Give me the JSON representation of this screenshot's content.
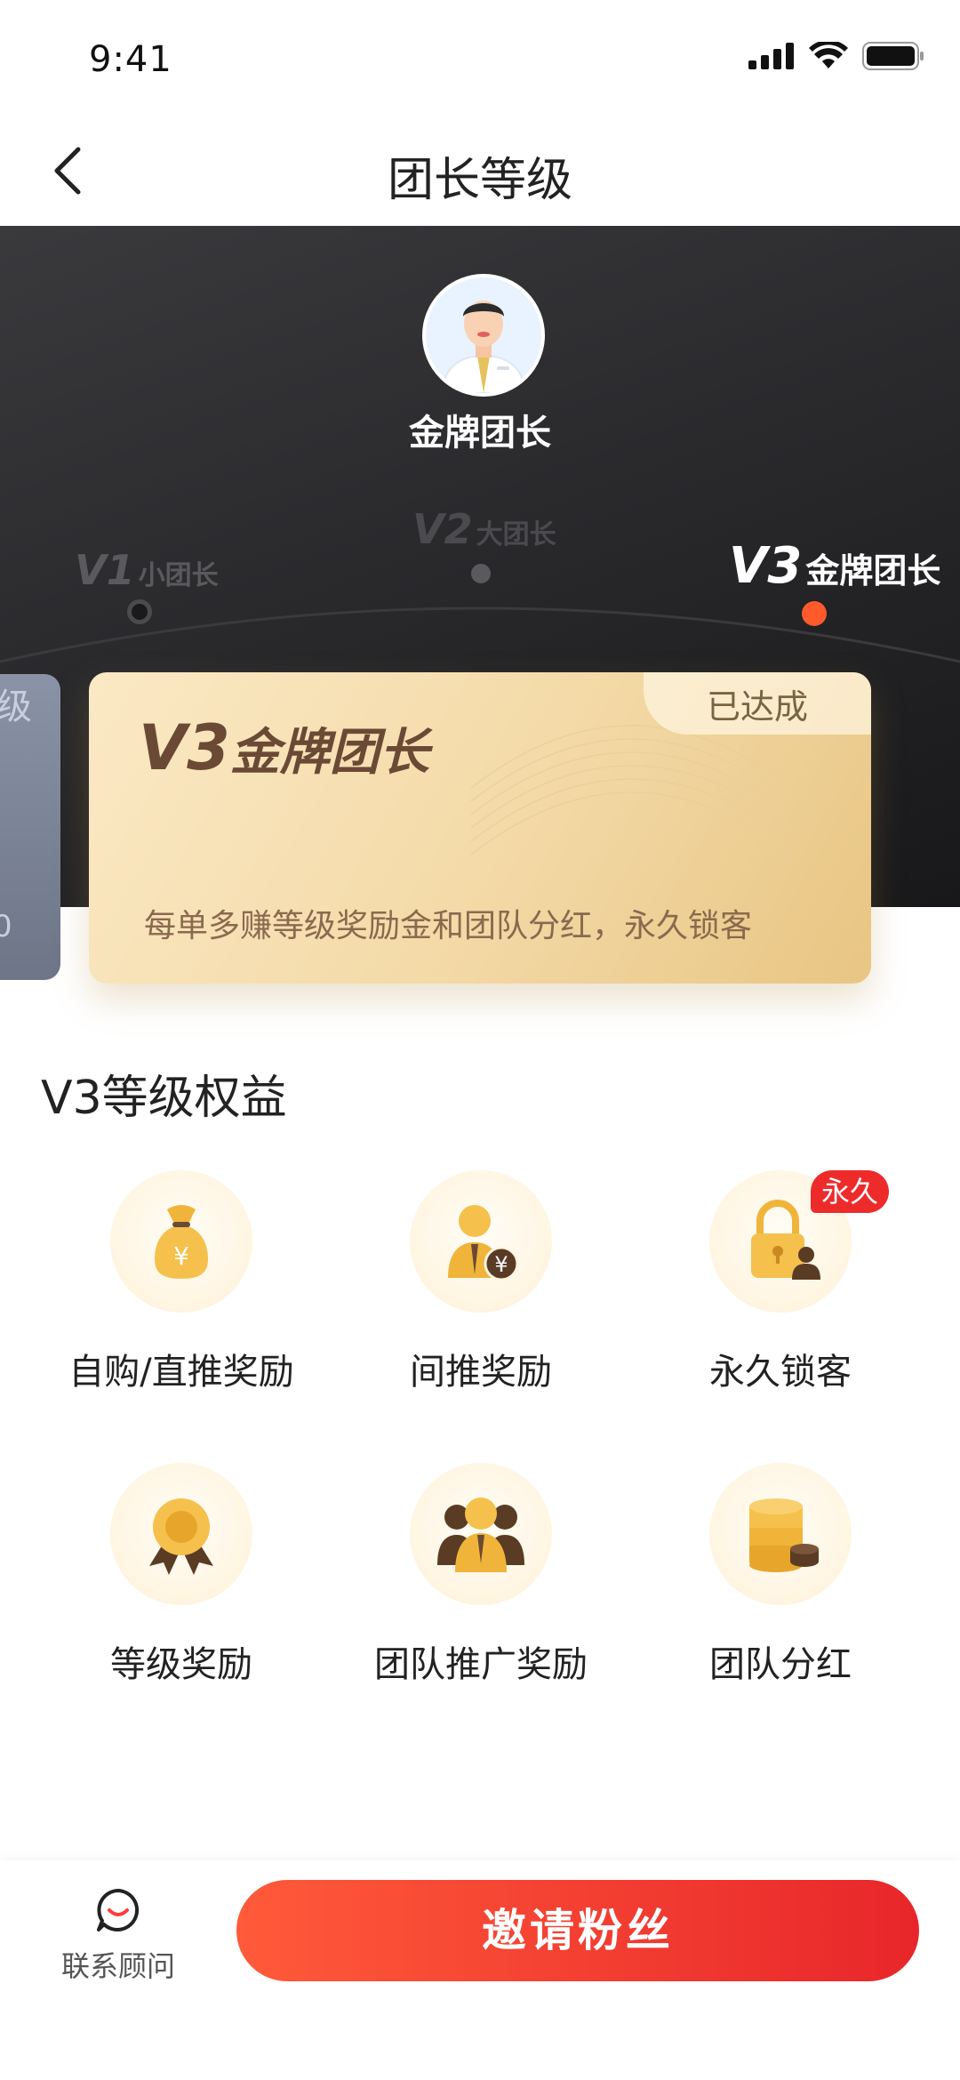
{
  "status_bar": {
    "time": "9:41"
  },
  "nav": {
    "title": "团长等级"
  },
  "hero": {
    "name": "金牌团长",
    "levels": [
      {
        "code": "V1",
        "text": "小团长"
      },
      {
        "code": "V2",
        "text": "大团长"
      },
      {
        "code": "V3",
        "text": "金牌团长"
      }
    ],
    "prev_card": {
      "top_text": "级",
      "bottom_text": "0"
    },
    "card": {
      "code": "V3",
      "title": "金牌团长",
      "status": "已达成",
      "desc": "每单多赚等级奖励金和团队分红，永久锁客"
    }
  },
  "benefits": {
    "title": "V3等级权益",
    "tag": "永久",
    "items": [
      {
        "label": "自购/直推奖励",
        "icon": "money-bag-icon"
      },
      {
        "label": "间推奖励",
        "icon": "person-yuan-icon"
      },
      {
        "label": "永久锁客",
        "icon": "lock-person-icon"
      },
      {
        "label": "等级奖励",
        "icon": "medal-icon"
      },
      {
        "label": "团队推广奖励",
        "icon": "team-icon"
      },
      {
        "label": "团队分红",
        "icon": "coin-stack-icon"
      }
    ]
  },
  "bottom": {
    "advisor_label": "联系顾问",
    "invite_label": "邀请粉丝"
  },
  "colors": {
    "accent": "#ff5a2c",
    "gold": "#f0c15a",
    "card_brown": "#6a4a35",
    "tag_red": "#ee2b2b"
  }
}
